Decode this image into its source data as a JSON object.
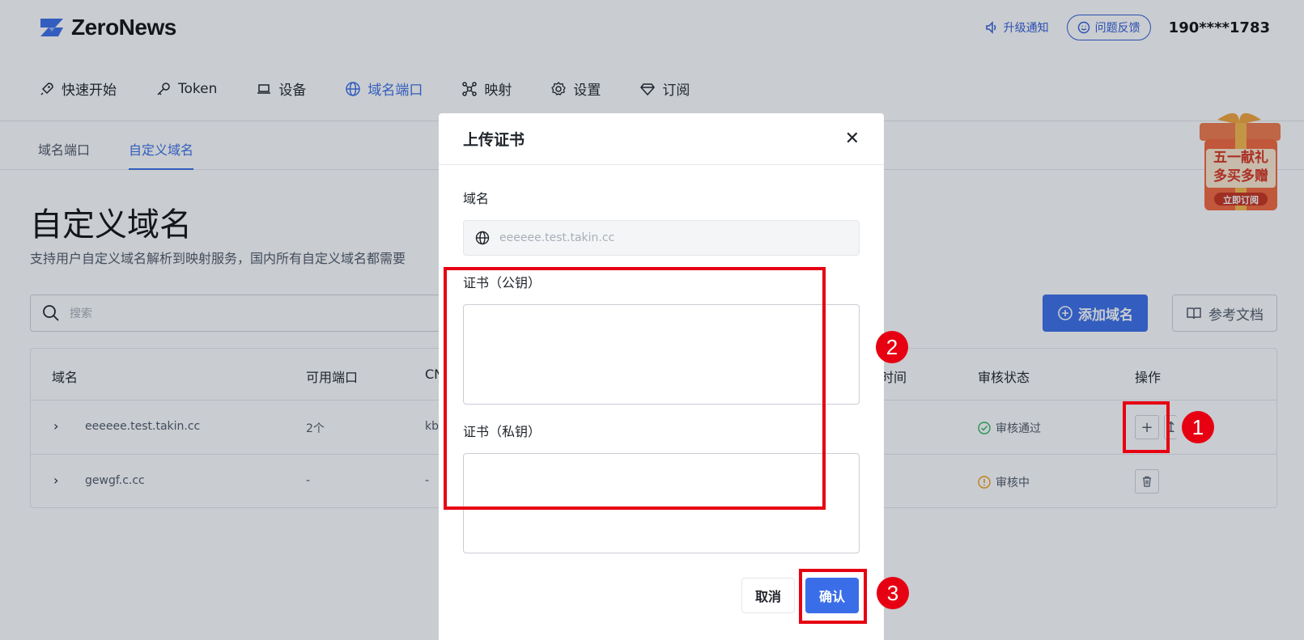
{
  "header": {
    "logo_text": "ZeroNews",
    "upgrade_notice": "升级通知",
    "feedback": "问题反馈",
    "user": "190****1783"
  },
  "nav": {
    "items": [
      {
        "label": "快速开始",
        "icon": "rocket-icon"
      },
      {
        "label": "Token",
        "icon": "key-icon"
      },
      {
        "label": "设备",
        "icon": "laptop-icon"
      },
      {
        "label": "域名端口",
        "icon": "globe-icon",
        "active": true
      },
      {
        "label": "映射",
        "icon": "network-icon"
      },
      {
        "label": "设置",
        "icon": "gear-icon"
      },
      {
        "label": "订阅",
        "icon": "diamond-icon"
      }
    ]
  },
  "subtabs": [
    "域名端口",
    "自定义域名"
  ],
  "page": {
    "title": "自定义域名",
    "description": "支持用户自定义域名解析到映射服务，国内所有自定义域名都需要",
    "search_placeholder": "搜索",
    "add_button": "添加域名",
    "doc_button": "参考文档"
  },
  "table": {
    "headers": [
      "域名",
      "可用端口",
      "CN",
      "时间",
      "审核状态",
      "操作"
    ],
    "rows": [
      {
        "domain": "eeeeee.test.takin.cc",
        "ports": "2个",
        "cname": "kb",
        "status": "审核通过",
        "status_color": "#2db55d"
      },
      {
        "domain": "gewgf.c.cc",
        "ports": "-",
        "cname": "-",
        "status": "审核中",
        "status_color": "#f29d0e"
      }
    ]
  },
  "promo": {
    "line1": "五一献礼",
    "line2": "多买多赠",
    "cta": "立即订阅"
  },
  "modal": {
    "title": "上传证书",
    "domain_label": "域名",
    "domain_value": "eeeeee.test.takin.cc",
    "public_key_label": "证书（公钥）",
    "private_key_label": "证书（私钥）",
    "cancel": "取消",
    "confirm": "确认"
  },
  "annotations": [
    "1",
    "2",
    "3"
  ],
  "colors": {
    "accent": "#3a6ee8",
    "annotation": "#e60012"
  }
}
